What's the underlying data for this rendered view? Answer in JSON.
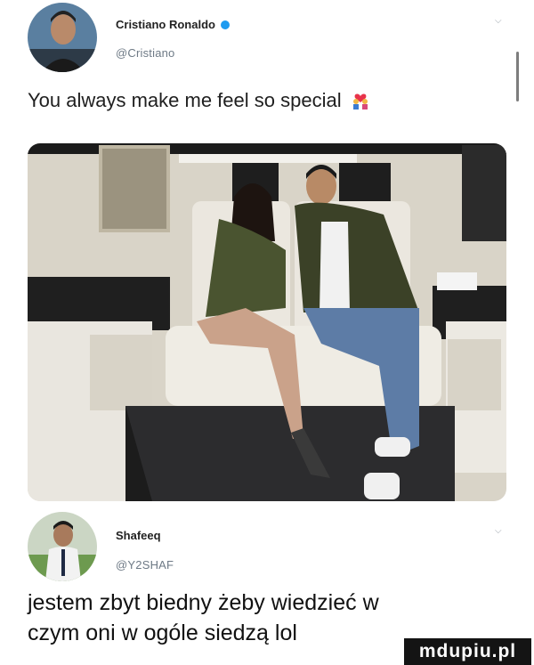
{
  "tweet": {
    "author_name": "Cristiano Ronaldo",
    "author_handle": "@Cristiano",
    "text": "You always make me feel so special",
    "emoji": "couple-with-heart-emoji",
    "verified": true
  },
  "reply": {
    "author_name": "Shafeeq",
    "author_handle": "@Y2SHAF",
    "text_line1": "jestem zbyt biedny żeby wiedzieć w",
    "text_line2": "czym oni w ogóle siedzą lol"
  },
  "watermark": "mdupiu.pl",
  "colors": {
    "verified_badge": "#1d9bf0",
    "handle_gray": "#6e7a86",
    "van_interior": "#e7e3da",
    "carpet": "#2c2c2e"
  }
}
